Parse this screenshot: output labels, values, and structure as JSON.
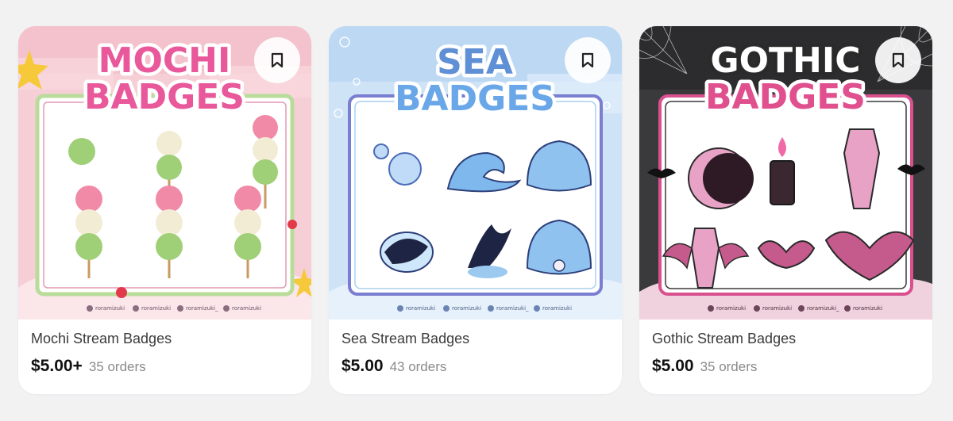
{
  "products": [
    {
      "title": "Mochi Stream Badges",
      "price": "$5.00+",
      "orders": "35 orders",
      "banner": {
        "line1": "MOCHI",
        "line2": "BADGES"
      },
      "socials": [
        "roramizuki",
        "roramizuki",
        "roramizuki_",
        "roramizuki"
      ],
      "bookmark_icon": "bookmark-icon"
    },
    {
      "title": "Sea Stream Badges",
      "price": "$5.00",
      "orders": "43 orders",
      "banner": {
        "line1": "SEA",
        "line2": "BADGES"
      },
      "socials": [
        "roramizuki",
        "roramizuki",
        "roramizuki_",
        "roramizuki"
      ],
      "bookmark_icon": "bookmark-icon"
    },
    {
      "title": "Gothic Stream Badges",
      "price": "$5.00",
      "orders": "35 orders",
      "banner": {
        "line1": "GOTHIC",
        "line2": "BADGES"
      },
      "socials": [
        "roramizuki",
        "roramizuki",
        "roramizuki_",
        "roramizuki"
      ],
      "bookmark_icon": "bookmark-icon"
    }
  ],
  "colors": {
    "page_bg": "#f2f2f3",
    "mochi_pink": "#e8589a",
    "sea_blue": "#5f8fd4",
    "gothic_pink": "#e0508e"
  }
}
